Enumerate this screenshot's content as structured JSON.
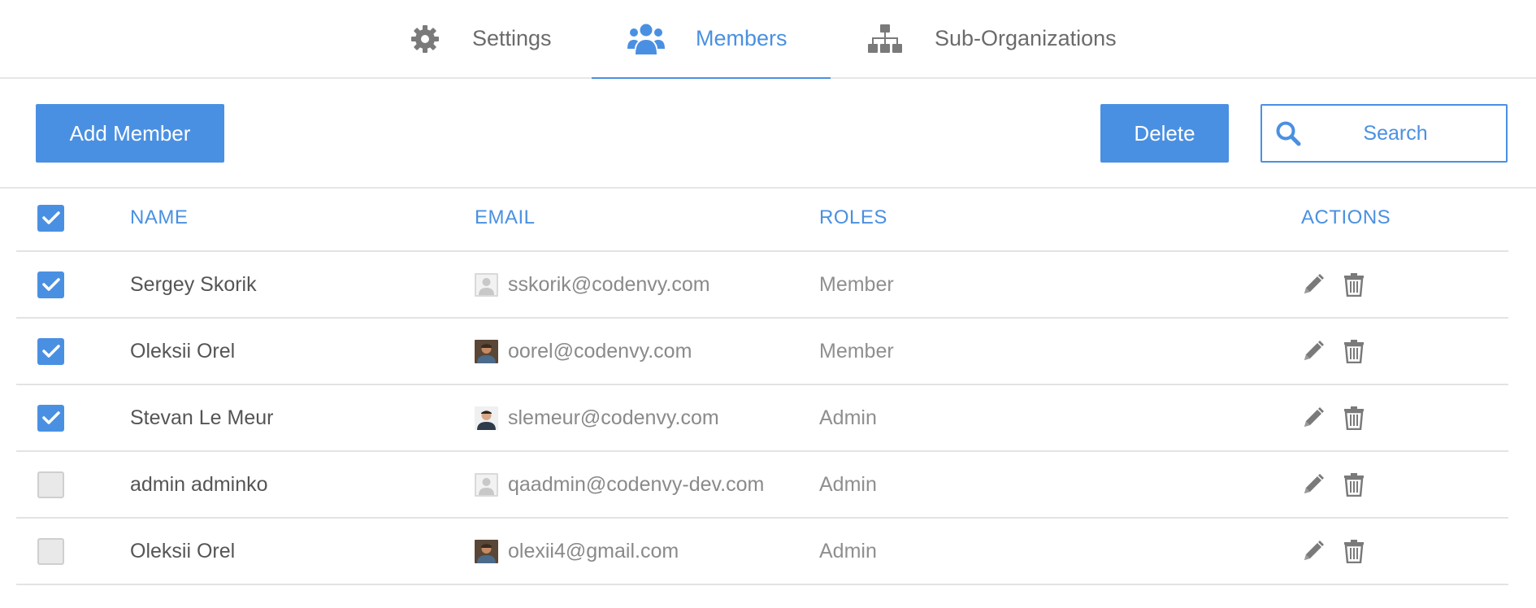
{
  "tabs": [
    {
      "label": "Settings",
      "icon": "gear-icon",
      "active": false
    },
    {
      "label": "Members",
      "icon": "users-icon",
      "active": true
    },
    {
      "label": "Sub-Organizations",
      "icon": "sitemap-icon",
      "active": false
    }
  ],
  "toolbar": {
    "add_label": "Add Member",
    "delete_label": "Delete",
    "search_placeholder": "Search"
  },
  "table": {
    "headers": {
      "name": "NAME",
      "email": "EMAIL",
      "roles": "ROLES",
      "actions": "ACTIONS"
    },
    "header_checked": true,
    "rows": [
      {
        "checked": true,
        "name": "Sergey Skorik",
        "email": "sskorik@codenvy.com",
        "role": "Member",
        "avatar": "placeholder-avatar"
      },
      {
        "checked": true,
        "name": "Oleksii Orel",
        "email": "oorel@codenvy.com",
        "role": "Member",
        "avatar": "photo-avatar"
      },
      {
        "checked": true,
        "name": "Stevan Le Meur",
        "email": "slemeur@codenvy.com",
        "role": "Admin",
        "avatar": "photo-avatar"
      },
      {
        "checked": false,
        "name": "admin adminko",
        "email": "qaadmin@codenvy-dev.com",
        "role": "Admin",
        "avatar": "placeholder-avatar"
      },
      {
        "checked": false,
        "name": "Oleksii Orel",
        "email": "olexii4@gmail.com",
        "role": "Admin",
        "avatar": "photo-avatar"
      }
    ]
  },
  "colors": {
    "accent": "#4a90e2",
    "icon_gray": "#7a7a7a",
    "border": "#e3e3e3"
  }
}
